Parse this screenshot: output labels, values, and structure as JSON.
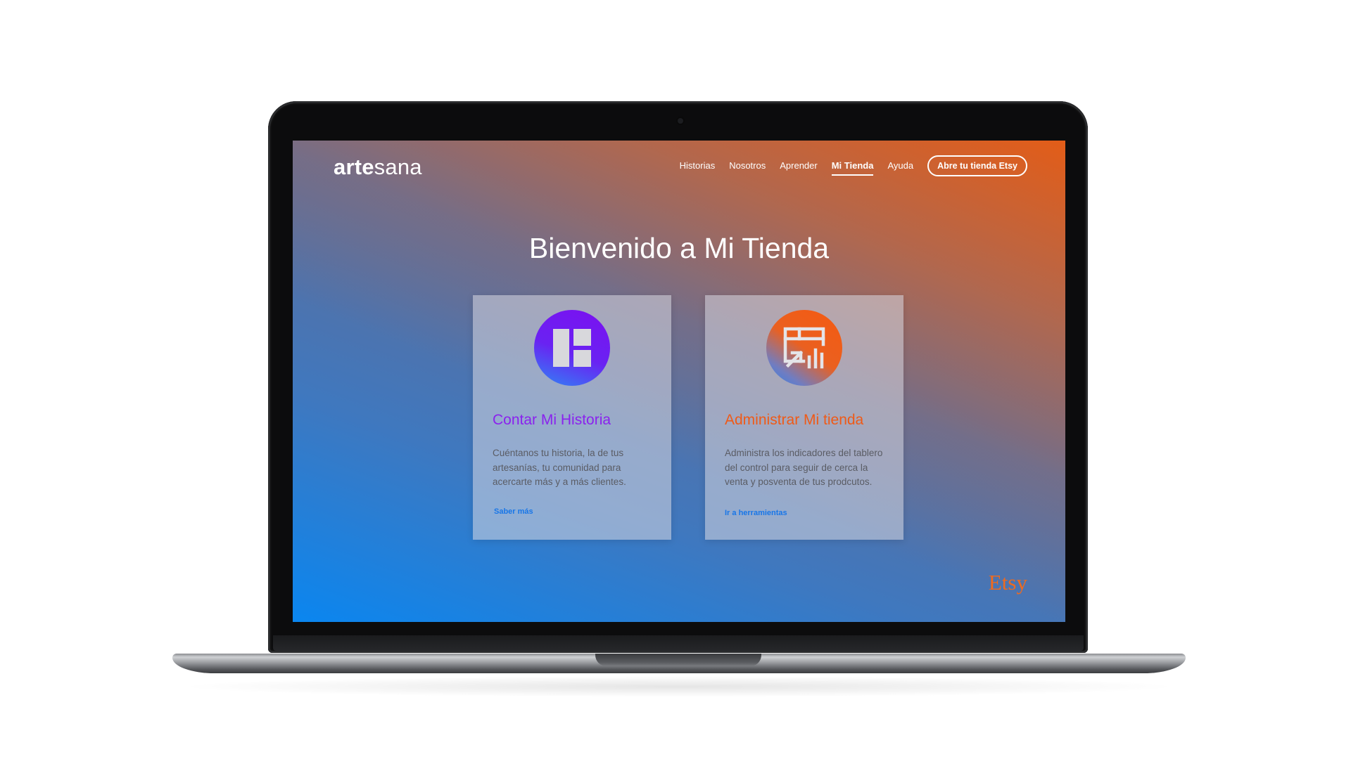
{
  "header": {
    "brand_bold": "arte",
    "brand_regular": "sana",
    "nav": [
      {
        "label": "Historias",
        "active": false
      },
      {
        "label": "Nosotros",
        "active": false
      },
      {
        "label": "Aprender",
        "active": false
      },
      {
        "label": "Mi Tienda",
        "active": true
      },
      {
        "label": "Ayuda",
        "active": false
      }
    ],
    "cta_label": "Abre tu tienda Etsy"
  },
  "hero": {
    "title": "Bienvenido a Mi Tienda"
  },
  "cards": [
    {
      "icon": "layout-icon",
      "title": "Contar Mi Historia",
      "description": "Cuéntanos tu historia, la de tus artesanías, tu comunidad para acercarte más y a más clientes.",
      "link": "Saber más"
    },
    {
      "icon": "dashboard-analytics-icon",
      "title": "Administrar Mi tienda",
      "description": "Administra los indicadores del tablero del control para seguir de cerca la venta y posventa de tus prodcutos.",
      "link": "Ir a herramientas"
    }
  ],
  "footer": {
    "partner_logo": "Etsy"
  },
  "colors": {
    "accent_purple": "#8a22ee",
    "accent_orange": "#ef5a17",
    "link_blue": "#1876e8"
  }
}
